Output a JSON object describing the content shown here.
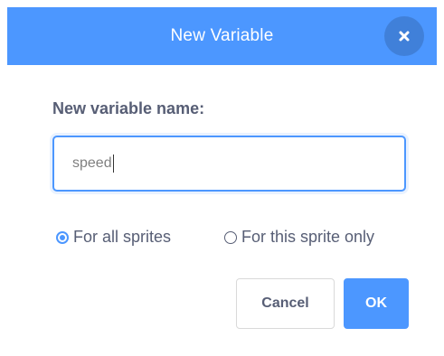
{
  "dialog": {
    "title": "New Variable",
    "accent_color": "#4c97ff",
    "text_color": "#575e75"
  },
  "form": {
    "label": "New variable name:",
    "input_value": "speed"
  },
  "scope": {
    "options": [
      {
        "label": "For all sprites",
        "checked": true
      },
      {
        "label": "For this sprite only",
        "checked": false
      }
    ]
  },
  "actions": {
    "cancel_label": "Cancel",
    "ok_label": "OK"
  },
  "icons": {
    "close": "close-icon",
    "radio_selected": "radio-selected-icon",
    "radio_unselected": "radio-unselected-icon"
  }
}
